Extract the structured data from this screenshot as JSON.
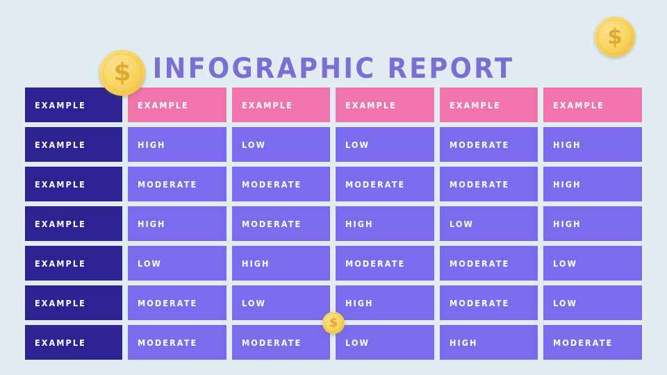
{
  "page": {
    "title": "INFOGRAPHIC REPORT",
    "background_color": "#e1edf2",
    "title_color": "#7b6fd6"
  },
  "colors": {
    "label_column": "#2e2191",
    "header_cell": "#f075ae",
    "data_cell": "#7c6ced",
    "cell_text": "#ffffff",
    "coin_fill": "#f8d765",
    "coin_symbol": "#dfa92f"
  },
  "table": {
    "header_row": [
      "EXAMPLE",
      "EXAMPLE",
      "EXAMPLE",
      "EXAMPLE",
      "EXAMPLE",
      "EXAMPLE"
    ],
    "rows": [
      [
        "EXAMPLE",
        "HIGH",
        "LOW",
        "LOW",
        "MODERATE",
        "HIGH"
      ],
      [
        "EXAMPLE",
        "MODERATE",
        "MODERATE",
        "MODERATE",
        "MODERATE",
        "HIGH"
      ],
      [
        "EXAMPLE",
        "HIGH",
        "MODERATE",
        "HIGH",
        "LOW",
        "HIGH"
      ],
      [
        "EXAMPLE",
        "LOW",
        "HIGH",
        "MODERATE",
        "MODERATE",
        "LOW"
      ],
      [
        "EXAMPLE",
        "MODERATE",
        "LOW",
        "HIGH",
        "MODERATE",
        "LOW"
      ],
      [
        "EXAMPLE",
        "MODERATE",
        "MODERATE",
        "LOW",
        "HIGH",
        "MODERATE"
      ]
    ]
  },
  "decorations": {
    "coins": [
      {
        "name": "coin-large-left",
        "symbol": "$"
      },
      {
        "name": "coin-medium-right",
        "symbol": "$"
      },
      {
        "name": "coin-small-center",
        "symbol": "$"
      }
    ]
  }
}
